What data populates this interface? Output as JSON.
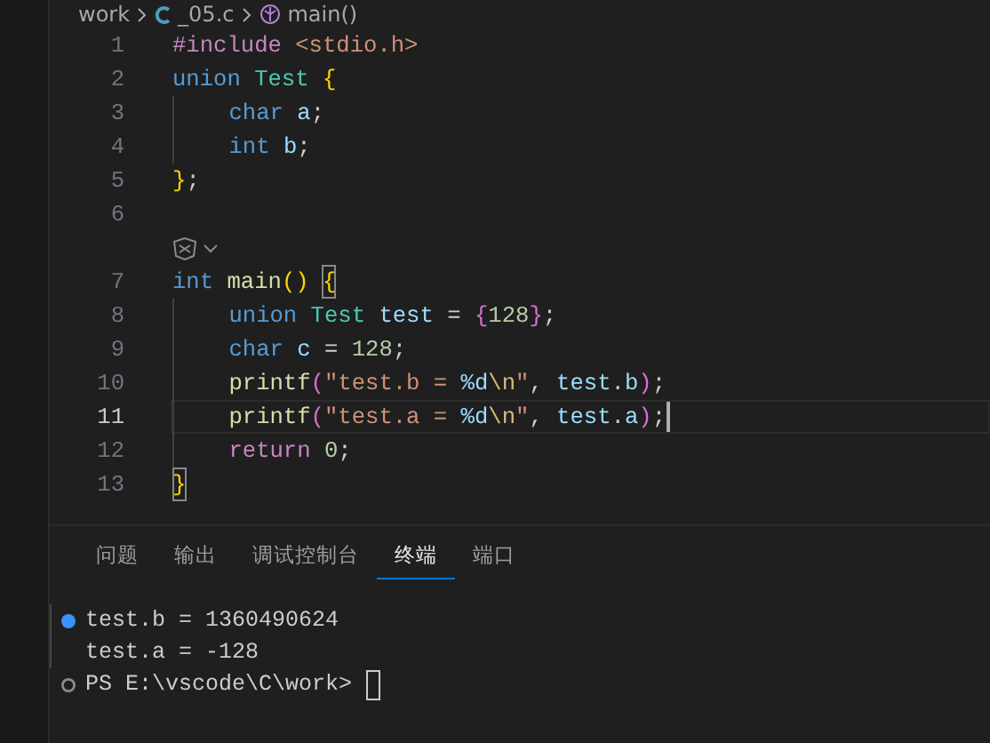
{
  "breadcrumb": [
    {
      "text": "work",
      "kind": "folder"
    },
    {
      "text": "_05.c",
      "kind": "cfile"
    },
    {
      "text": "main()",
      "kind": "function"
    }
  ],
  "code_lines": [
    {
      "kind": "code",
      "number": "1",
      "current": false,
      "tokens": [
        {
          "t": "#include ",
          "kind": "directive"
        },
        {
          "t": "<stdio.h>",
          "kind": "string"
        }
      ]
    },
    {
      "kind": "code",
      "number": "2",
      "current": false,
      "tokens": [
        {
          "t": "union ",
          "kind": "keyword"
        },
        {
          "t": "Test ",
          "kind": "type"
        },
        {
          "t": "{",
          "kind": "bracket1"
        }
      ]
    },
    {
      "kind": "code",
      "number": "3",
      "current": false,
      "tokens": [
        {
          "t": "    char ",
          "kind": "keyword"
        },
        {
          "t": "a",
          "kind": "variable"
        },
        {
          "t": ";",
          "kind": "plain"
        }
      ]
    },
    {
      "kind": "code",
      "number": "4",
      "current": false,
      "tokens": [
        {
          "t": "    int ",
          "kind": "keyword"
        },
        {
          "t": "b",
          "kind": "variable"
        },
        {
          "t": ";",
          "kind": "plain"
        }
      ]
    },
    {
      "kind": "code",
      "number": "5",
      "current": false,
      "tokens": [
        {
          "t": "}",
          "kind": "bracket1"
        },
        {
          "t": ";",
          "kind": "plain"
        }
      ]
    },
    {
      "kind": "code",
      "number": "6",
      "current": false
    },
    {
      "kind": "codelens"
    },
    {
      "kind": "code",
      "number": "7",
      "current": false,
      "tokens": [
        {
          "t": "int ",
          "kind": "keyword"
        },
        {
          "t": "main",
          "kind": "function"
        },
        {
          "t": "() ",
          "kind": "bracket1"
        },
        {
          "t": "{",
          "kind": "bracket1-match"
        }
      ]
    },
    {
      "kind": "code",
      "number": "8",
      "current": false,
      "tokens": [
        {
          "t": "    union ",
          "kind": "keyword"
        },
        {
          "t": "Test ",
          "kind": "type"
        },
        {
          "t": "test",
          "kind": "variable"
        },
        {
          "t": " = ",
          "kind": "plain"
        },
        {
          "t": "{",
          "kind": "bracket2"
        },
        {
          "t": "128",
          "kind": "number"
        },
        {
          "t": "}",
          "kind": "bracket2"
        },
        {
          "t": ";",
          "kind": "plain"
        }
      ]
    },
    {
      "kind": "code",
      "number": "9",
      "current": false,
      "tokens": [
        {
          "t": "    char ",
          "kind": "keyword"
        },
        {
          "t": "c",
          "kind": "variable"
        },
        {
          "t": " = ",
          "kind": "plain"
        },
        {
          "t": "128",
          "kind": "number"
        },
        {
          "t": ";",
          "kind": "plain"
        }
      ]
    },
    {
      "kind": "code",
      "number": "10",
      "current": false,
      "tokens": [
        {
          "t": "    printf",
          "kind": "function"
        },
        {
          "t": "(",
          "kind": "bracket2"
        },
        {
          "t": "\"test.b = ",
          "kind": "string"
        },
        {
          "t": "%d",
          "kind": "format"
        },
        {
          "t": "\\n",
          "kind": "escape"
        },
        {
          "t": "\"",
          "kind": "string"
        },
        {
          "t": ", ",
          "kind": "plain"
        },
        {
          "t": "test",
          "kind": "variable"
        },
        {
          "t": ".",
          "kind": "plain"
        },
        {
          "t": "b",
          "kind": "variable"
        },
        {
          "t": ")",
          "kind": "bracket2"
        },
        {
          "t": ";",
          "kind": "plain"
        }
      ]
    },
    {
      "kind": "code",
      "number": "11",
      "current": true,
      "tokens": [
        {
          "t": "    printf",
          "kind": "function"
        },
        {
          "t": "(",
          "kind": "bracket2"
        },
        {
          "t": "\"test.a = ",
          "kind": "string"
        },
        {
          "t": "%d",
          "kind": "format"
        },
        {
          "t": "\\n",
          "kind": "escape"
        },
        {
          "t": "\"",
          "kind": "string"
        },
        {
          "t": ", ",
          "kind": "plain"
        },
        {
          "t": "test",
          "kind": "variable"
        },
        {
          "t": ".",
          "kind": "plain"
        },
        {
          "t": "a",
          "kind": "variable"
        },
        {
          "t": ")",
          "kind": "bracket2"
        },
        {
          "t": ";",
          "kind": "plain"
        }
      ]
    },
    {
      "kind": "code",
      "number": "12",
      "current": false,
      "tokens": [
        {
          "t": "    return ",
          "kind": "control"
        },
        {
          "t": "0",
          "kind": "number"
        },
        {
          "t": ";",
          "kind": "plain"
        }
      ]
    },
    {
      "kind": "code",
      "number": "13",
      "current": false,
      "tokens": [
        {
          "t": "}",
          "kind": "bracket1-match"
        }
      ]
    }
  ],
  "panel_tabs": [
    {
      "label": "问题",
      "selected": false
    },
    {
      "label": "输出",
      "selected": false
    },
    {
      "label": "调试控制台",
      "selected": false
    },
    {
      "label": "终端",
      "selected": true
    },
    {
      "label": "端口",
      "selected": false
    }
  ],
  "terminal_lines": [
    {
      "text": "test.b = 1360490624",
      "kind": "command-output"
    },
    {
      "text": "test.a = -128",
      "kind": "continued"
    },
    {
      "text": "PS E:\\vscode\\C\\work> ",
      "kind": "prompt"
    }
  ]
}
